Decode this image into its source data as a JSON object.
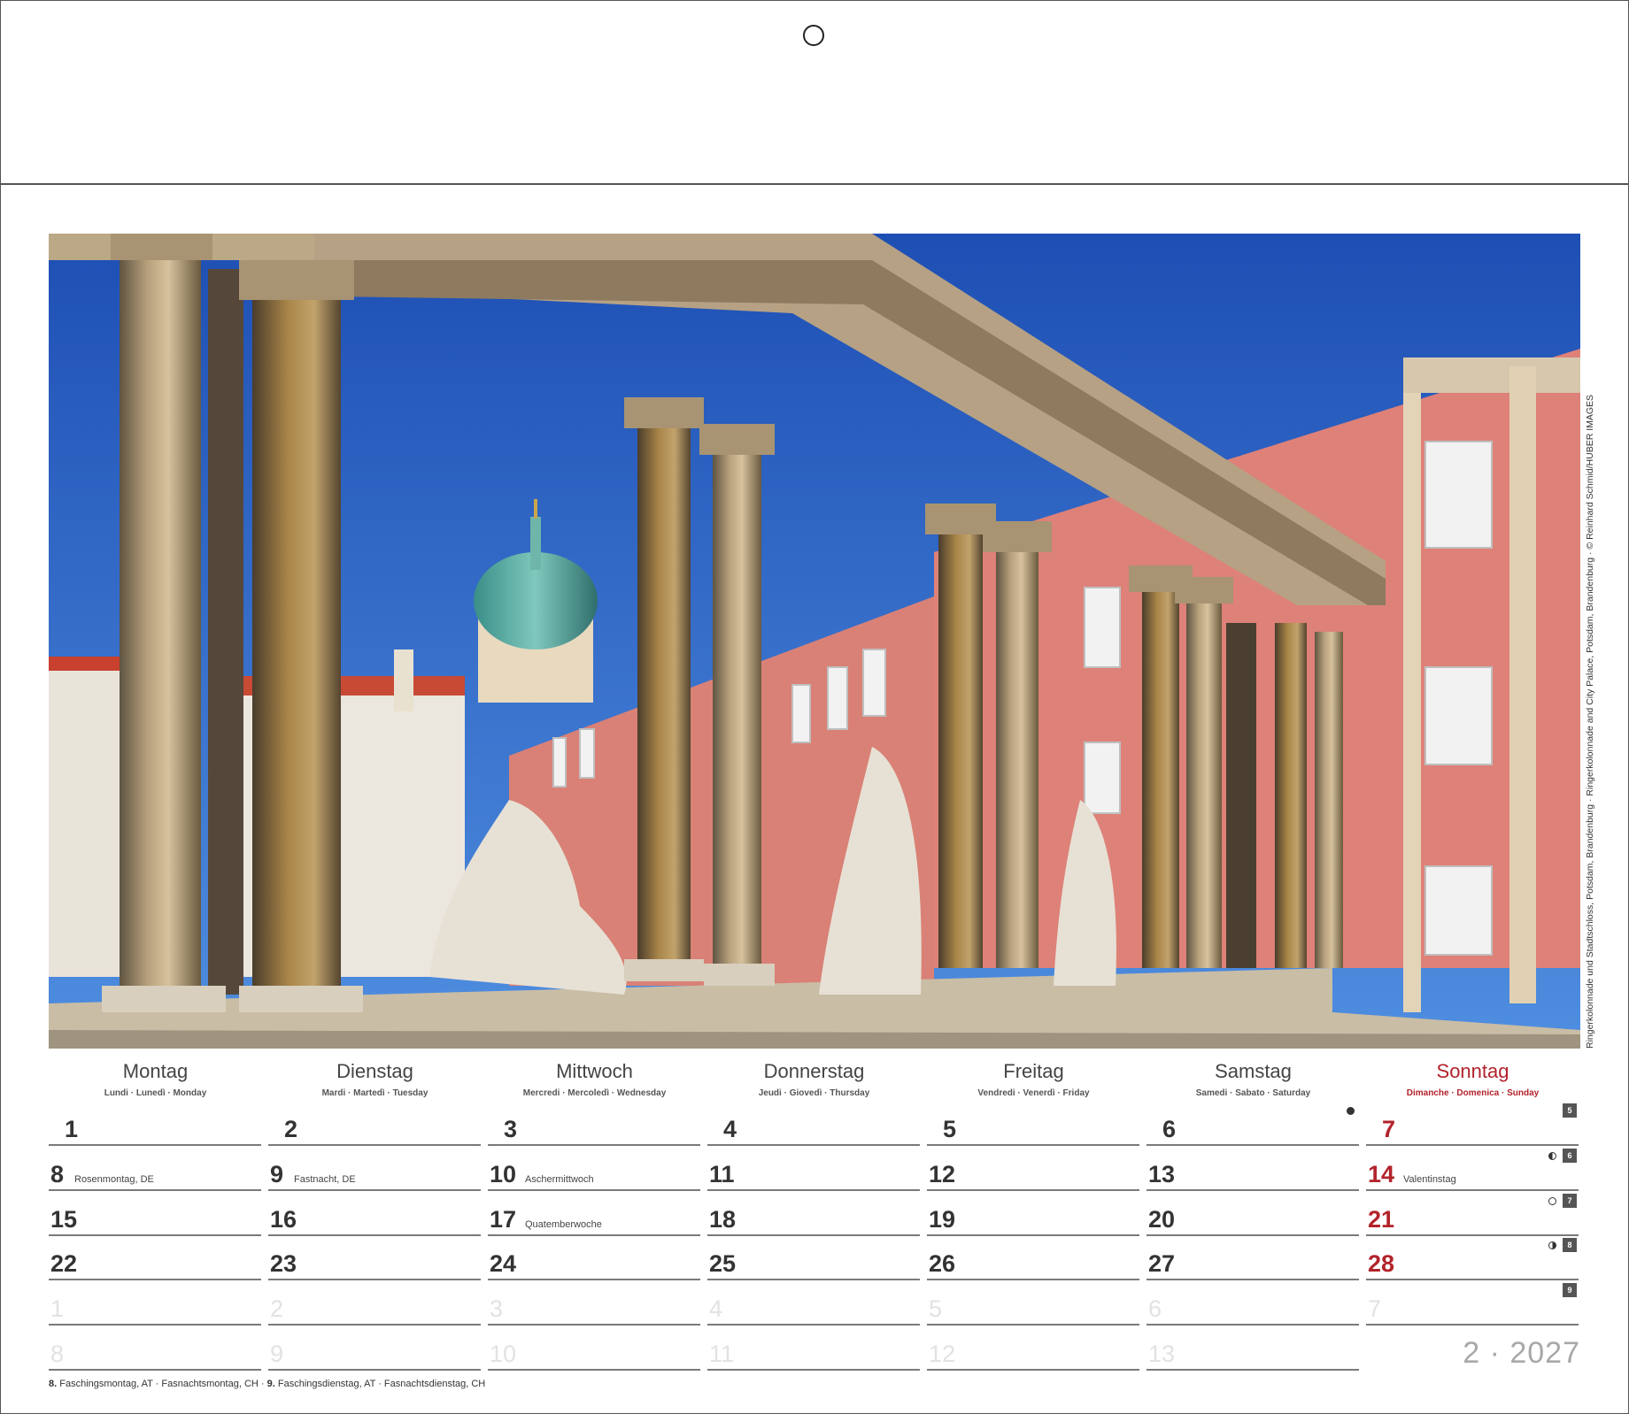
{
  "photo": {
    "subject": "Colonnade with statues in front of a city palace with pink facade and a green dome",
    "credit": "Ringerkolonnade und Stadtschloss, Potsdam, Brandenburg · Ringerkolonnade and City Palace, Potsdam, Brandenburg · © Reinhard Schmid/HUBER IMAGES"
  },
  "weekdays": [
    {
      "name": "Montag",
      "langs": "Lundi · Lunedì · Monday"
    },
    {
      "name": "Dienstag",
      "langs": "Mardi · Martedì · Tuesday"
    },
    {
      "name": "Mittwoch",
      "langs": "Mercredi · Mercoledì · Wednesday"
    },
    {
      "name": "Donnerstag",
      "langs": "Jeudi · Giovedì · Thursday"
    },
    {
      "name": "Freitag",
      "langs": "Vendredi · Venerdì · Friday"
    },
    {
      "name": "Samstag",
      "langs": "Samedi · Sabato · Saturday"
    },
    {
      "name": "Sonntag",
      "langs": "Dimanche · Domenica · Sunday"
    }
  ],
  "rows": [
    {
      "kw": "5",
      "days": [
        "1",
        "2",
        "3",
        "4",
        "5",
        "6",
        "7"
      ]
    },
    {
      "kw": "6",
      "days": [
        "8",
        "9",
        "10",
        "11",
        "12",
        "13",
        "14"
      ]
    },
    {
      "kw": "7",
      "days": [
        "15",
        "16",
        "17",
        "18",
        "19",
        "20",
        "21"
      ]
    },
    {
      "kw": "8",
      "days": [
        "22",
        "23",
        "24",
        "25",
        "26",
        "27",
        "28"
      ]
    },
    {
      "kw": "9",
      "days": [
        "1",
        "2",
        "3",
        "4",
        "5",
        "6",
        "7"
      ]
    },
    {
      "kw": "",
      "days": [
        "8",
        "9",
        "10",
        "11",
        "12",
        "13"
      ]
    }
  ],
  "notes": {
    "r1c0": "Rosenmontag, DE",
    "r1c1": "Fastnacht, DE",
    "r1c2": "Aschermittwoch",
    "r1c6": "Valentinstag",
    "r2c2": "Quatemberwoche"
  },
  "moon_phases": [
    "new-moon",
    "first-quarter",
    "full-moon",
    "last-quarter"
  ],
  "month_label": "2 · 2027",
  "footnote": {
    "d8": "8.",
    "d8_text": "Faschingsmontag, AT · Fasnachtsmontag, CH ·",
    "d9": "9.",
    "d9_text": "Faschingsdienstag, AT · Fasnachtsdienstag, CH"
  },
  "colors": {
    "sunday": "#b2232b",
    "rule": "#7a7a7a",
    "ghost": "#e2e2e2"
  }
}
